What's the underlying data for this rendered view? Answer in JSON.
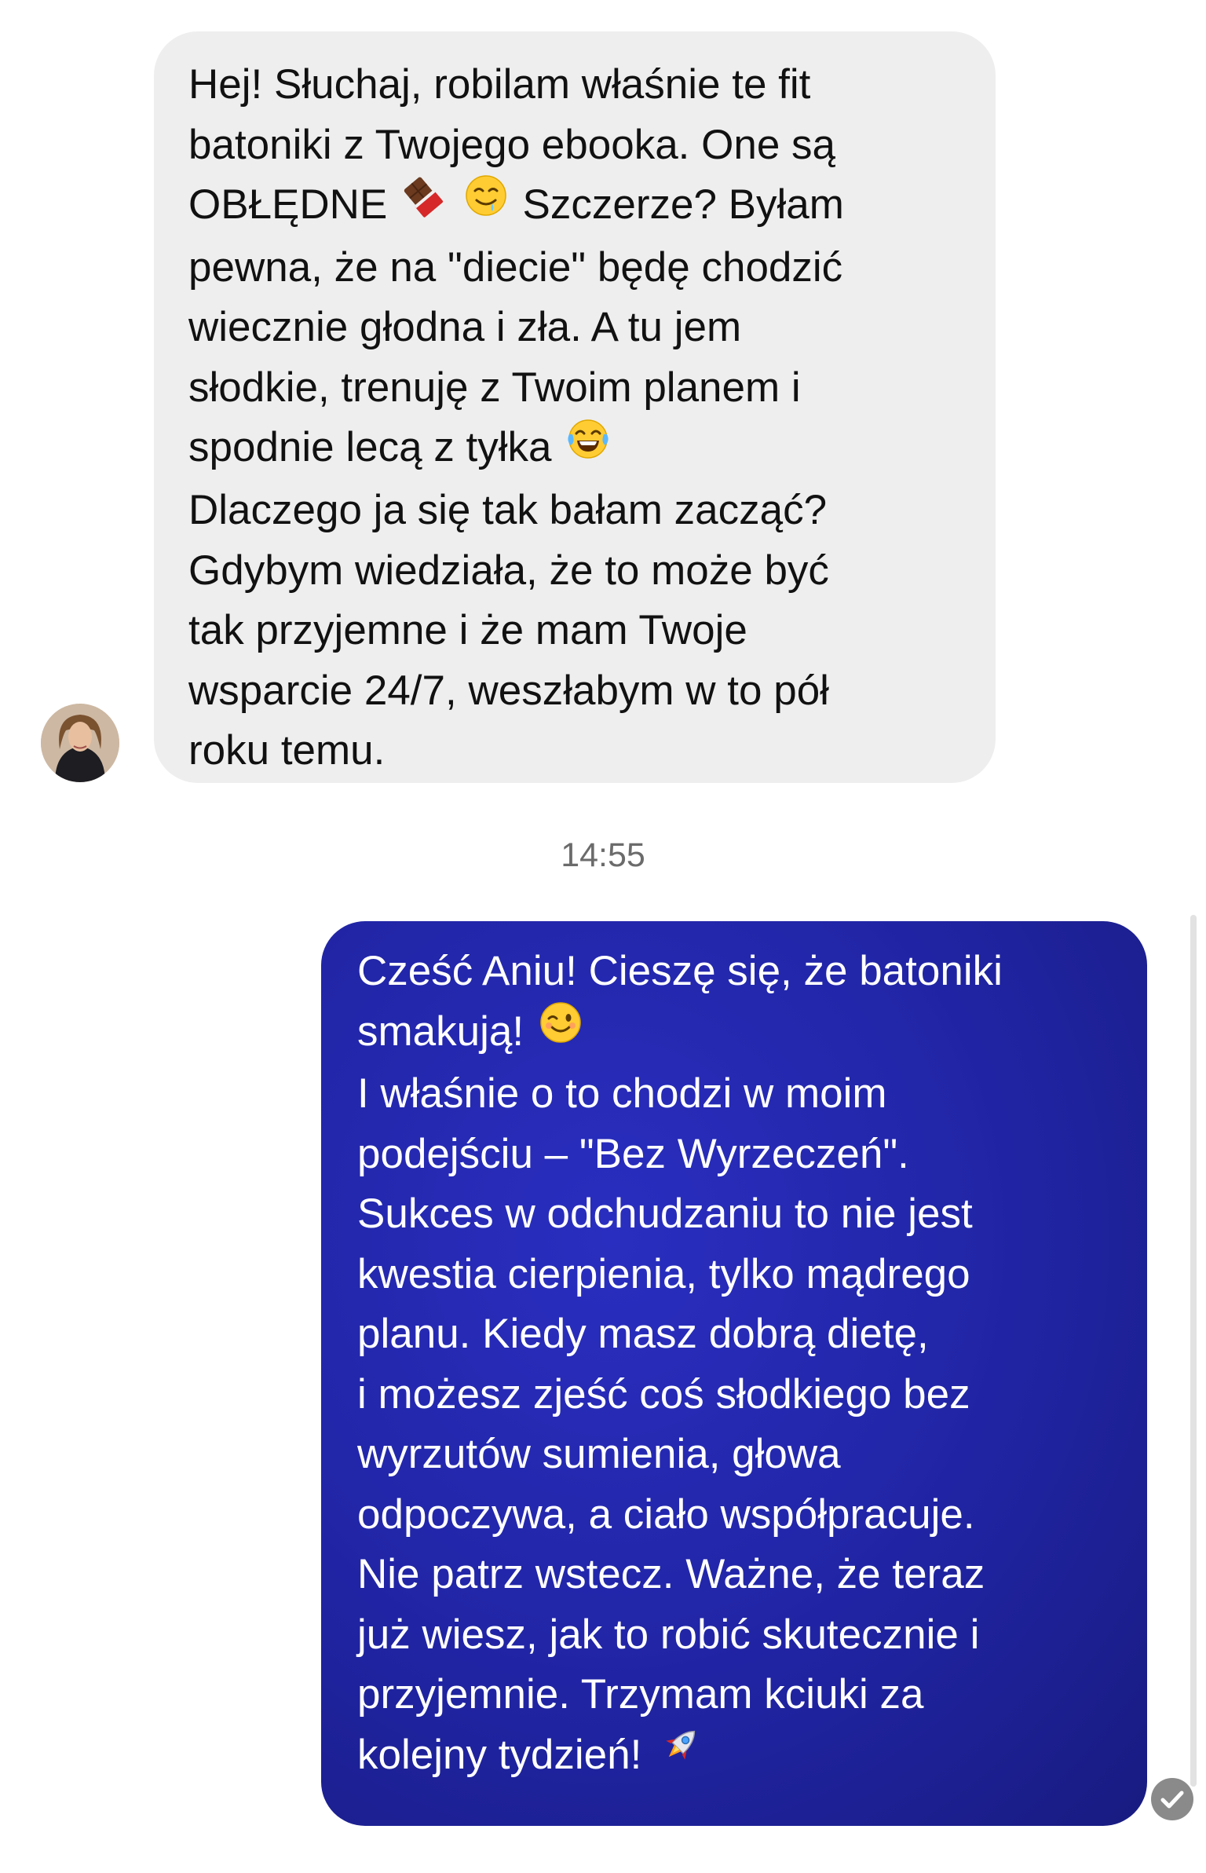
{
  "incoming_message": {
    "lines": [
      "Hej! Słuchaj, robilam właśnie te fit",
      "batoniki z Twojego ebooka. One są",
      "OBŁĘDNE",
      "Szczerze? Byłam",
      "pewna, że na \"diecie\" będę chodzić",
      "wiecznie głodna i zła. A tu jem",
      "słodkie, trenuję z Twoim planem i",
      "spodnie lecą z tyłka",
      "Dlaczego ja się tak bałam zacząć?",
      "Gdybym wiedziała, że to może być",
      "tak przyjemne i że mam Twoje",
      "wsparcie 24/7, weszłabym w to pół",
      "roku temu."
    ],
    "emojis": [
      "chocolate-bar",
      "drooling-face",
      "tears-of-joy"
    ]
  },
  "timestamp": "14:55",
  "outgoing_message": {
    "lines": [
      "Cześć Aniu! Cieszę się, że batoniki",
      "smakują!",
      "I właśnie o to chodzi w moim",
      "podejściu – \"Bez Wyrzeczeń\".",
      "Sukces w odchudzaniu to nie jest",
      "kwestia cierpienia, tylko mądrego",
      "planu. Kiedy masz dobrą dietę,",
      "i możesz zjeść coś słodkiego bez",
      "wyrzutów sumienia, głowa",
      "odpoczywa, a ciało współpracuje.",
      "Nie patrz wstecz. Ważne, że teraz",
      "już wiesz, jak to robić skutecznie i",
      "przyjemnie. Trzymam kciuki za",
      "kolejny tydzień!"
    ],
    "emojis": [
      "winking-face",
      "rocket"
    ]
  },
  "colors": {
    "incoming_bubble": "#eeeeee",
    "outgoing_bubble": "#2024a3",
    "timestamp_text": "#6b6b6b"
  }
}
